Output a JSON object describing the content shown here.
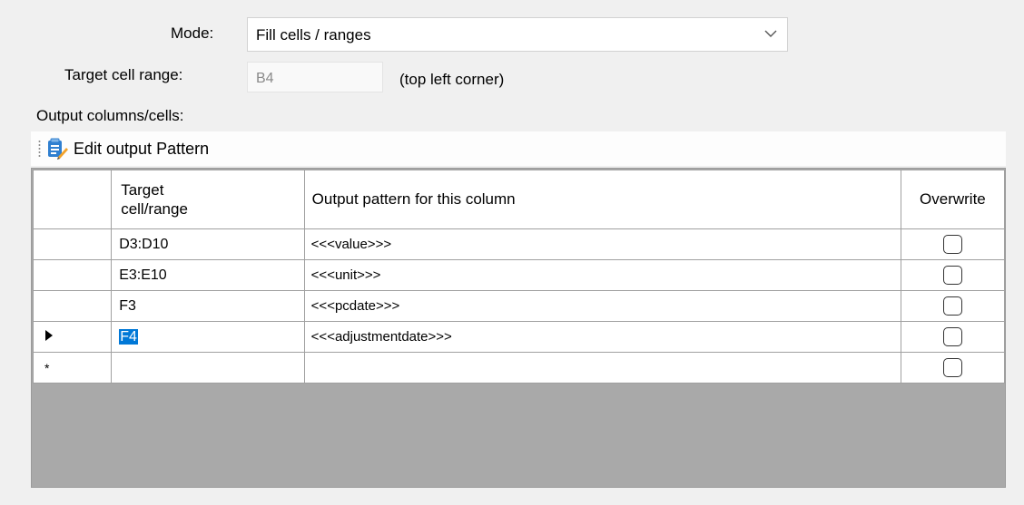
{
  "form": {
    "mode_label": "Mode:",
    "mode_value": "Fill cells / ranges",
    "target_label": "Target cell range:",
    "target_value": "B4",
    "target_hint": "(top left corner)",
    "output_label": "Output columns/cells:"
  },
  "toolbar": {
    "edit_button_label": "Edit output Pattern",
    "edit_button_icon": "edit-document-icon"
  },
  "grid": {
    "columns": {
      "target": "Target cell/range",
      "pattern": "Output pattern for this column",
      "overwrite": "Overwrite"
    },
    "rows": [
      {
        "target": "D3:D10",
        "pattern": "<<<value>>>",
        "overwrite": false
      },
      {
        "target": "E3:E10",
        "pattern": "<<<unit>>>",
        "overwrite": false
      },
      {
        "target": "F3",
        "pattern": "<<<pcdate>>>",
        "overwrite": false
      },
      {
        "target": "F4",
        "pattern": "<<<adjustmentdate>>>",
        "overwrite": false,
        "current": true
      },
      {
        "target": "",
        "pattern": "",
        "overwrite": false,
        "new_row": true
      }
    ],
    "new_row_marker": "*"
  },
  "colors": {
    "selection": "#0078d7",
    "grid_background": "#a9a9a9",
    "window_background": "#f0f0f0"
  }
}
